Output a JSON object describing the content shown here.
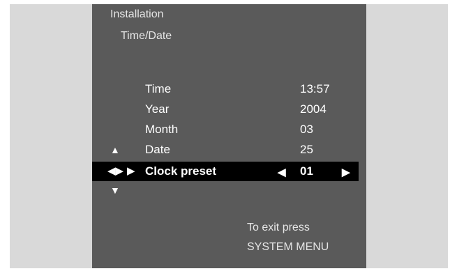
{
  "header": {
    "menu": "Installation",
    "submenu": "Time/Date"
  },
  "rows": [
    {
      "label": "Time",
      "value": "13:57"
    },
    {
      "label": "Year",
      "value": "2004"
    },
    {
      "label": "Month",
      "value": "03"
    },
    {
      "label": "Date",
      "value": "25"
    },
    {
      "label": "Clock preset",
      "value": "01"
    }
  ],
  "navigation": {
    "up": "▲",
    "left_right": "◀▶",
    "enter": "▶",
    "down": "▼",
    "value_decrease": "◀",
    "value_increase": "▶"
  },
  "footer": {
    "line1": "To exit press",
    "line2": "SYSTEM MENU"
  },
  "colors": {
    "screen_background": "#5a5a5a",
    "highlight_bar": "#000000",
    "text": "#ffffff",
    "outer_frame": "#d9d9d9"
  }
}
